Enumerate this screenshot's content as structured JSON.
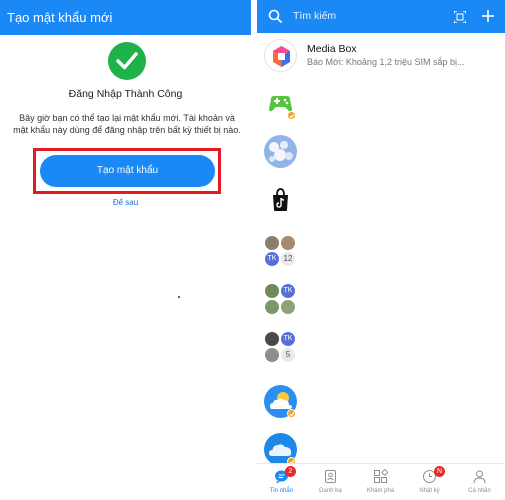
{
  "left": {
    "header_title": "Tạo mật khẩu mới",
    "success_title": "Đăng Nhập Thành Công",
    "description": "Bây giờ bạn có thể tạo lại mật khẩu mới. Tài khoản và mật khẩu này dùng để đăng nhập trên bất kỳ thiết bị nào.",
    "primary_button": "Tạo mật khẩu",
    "later_link": "Để sau",
    "colors": {
      "header": "#1a88f5",
      "success": "#1fb14a",
      "highlight": "#e21b23"
    }
  },
  "right": {
    "search_placeholder": "Tìm kiếm",
    "chats": [
      {
        "name": "Media Box",
        "preview": "Báo Mới: Khoảng 1,2 triệu SIM sắp bị..."
      }
    ],
    "group_counts": [
      "12",
      "5"
    ],
    "group_initials": "TK",
    "nav": [
      {
        "label": "Tin nhắn",
        "badge": "2",
        "icon": "chat-icon"
      },
      {
        "label": "Danh bạ",
        "icon": "contacts-icon"
      },
      {
        "label": "Khám phá",
        "icon": "discover-icon"
      },
      {
        "label": "Nhật ký",
        "badge": "N",
        "icon": "clock-icon"
      },
      {
        "label": "Cá nhân",
        "icon": "person-icon"
      }
    ]
  }
}
